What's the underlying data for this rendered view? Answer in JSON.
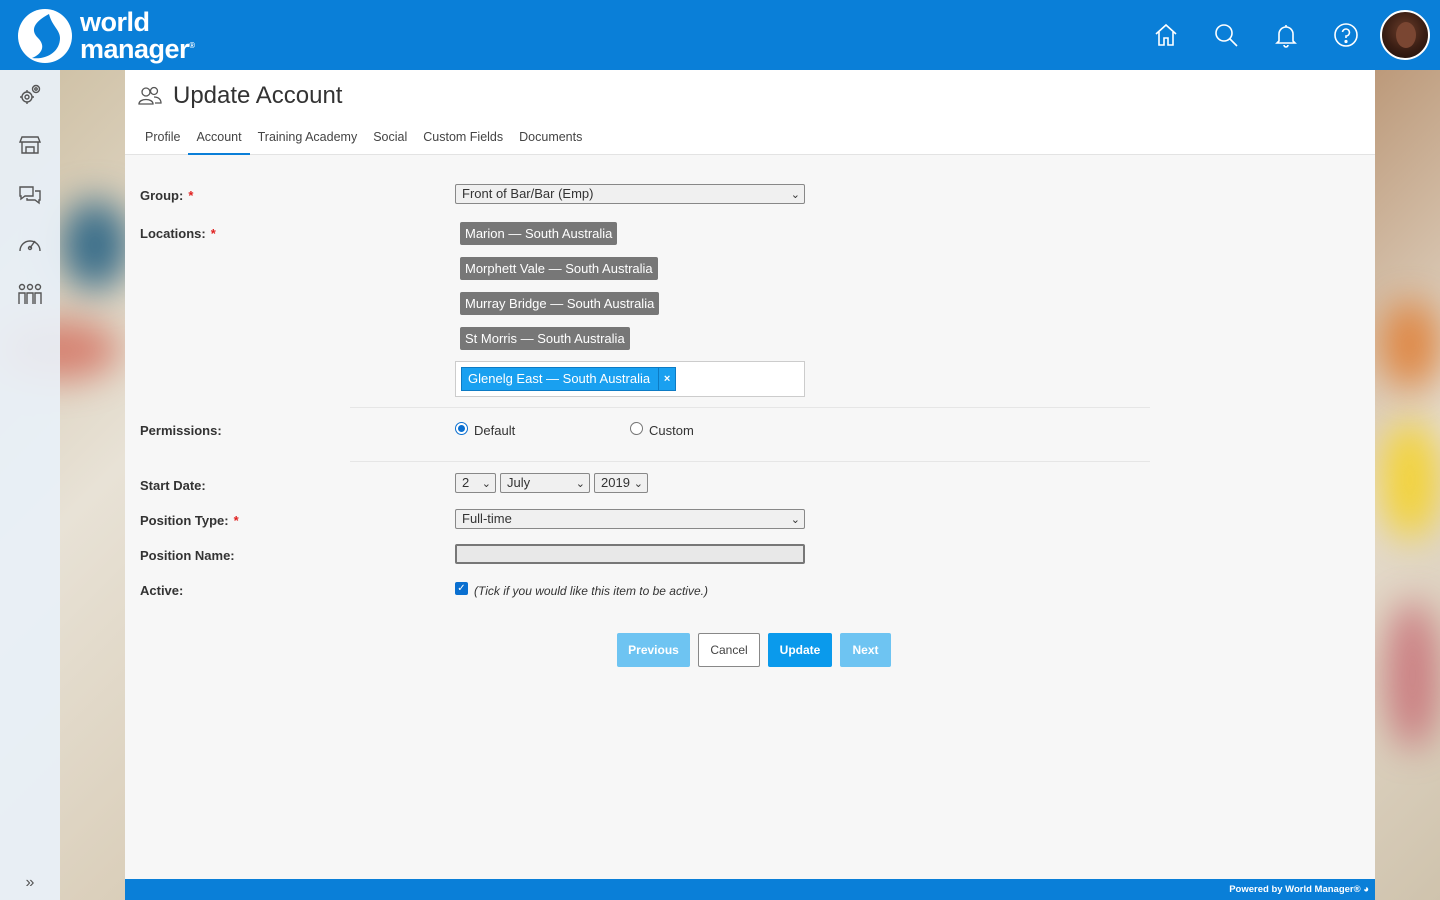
{
  "header": {
    "logo_line1": "world",
    "logo_line2": "manager",
    "logo_reg": "®",
    "icons": [
      "home-icon",
      "search-icon",
      "bell-icon",
      "help-icon"
    ],
    "accent": "#0a7fd8"
  },
  "sidebar": {
    "items": [
      "settings-icon",
      "store-icon",
      "chat-icon",
      "dashboard-icon",
      "people-icon"
    ],
    "expand_label": "»"
  },
  "page": {
    "title": "Update Account",
    "tabs": [
      "Profile",
      "Account",
      "Training Academy",
      "Social",
      "Custom Fields",
      "Documents"
    ],
    "active_tab": "Account"
  },
  "form": {
    "group_label": "Group:",
    "group_value": "Front of Bar/Bar (Emp)",
    "locations_label": "Locations:",
    "locations": [
      "Marion — South Australia",
      "Morphett Vale — South Australia",
      "Murray Bridge — South Australia",
      "St Morris — South Australia"
    ],
    "selected_location": "Glenelg East — South Australia",
    "remove_label": "×",
    "required_mark": "*",
    "permissions_label": "Permissions:",
    "perm_default": "Default",
    "perm_custom": "Custom",
    "perm_selected": "Default",
    "start_date_label": "Start Date:",
    "start_day": "2",
    "start_month": "July",
    "start_year": "2019",
    "position_type_label": "Position Type:",
    "position_type_value": "Full-time",
    "position_name_label": "Position Name:",
    "position_name_value": "",
    "active_label": "Active:",
    "active_checked": true,
    "active_hint": "(Tick if you would like this item to be active.)"
  },
  "buttons": {
    "previous": "Previous",
    "cancel": "Cancel",
    "update": "Update",
    "next": "Next"
  },
  "footer": {
    "text": "Powered by World Manager®"
  }
}
